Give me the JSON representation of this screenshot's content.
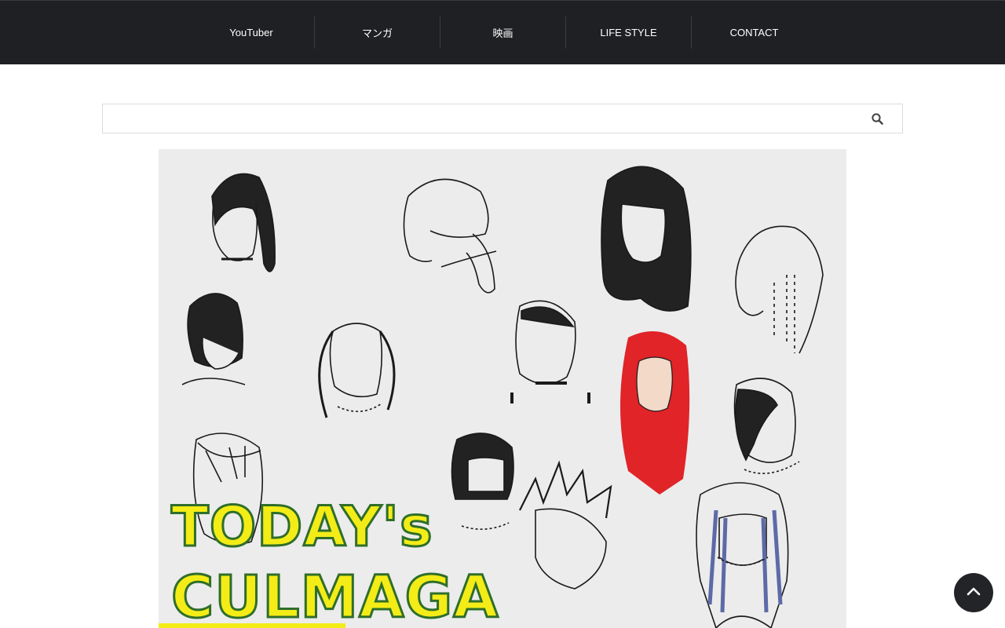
{
  "nav": {
    "items": [
      {
        "label": "YouTuber"
      },
      {
        "label": "マンガ"
      },
      {
        "label": "映画"
      },
      {
        "label": "LIFE STYLE"
      },
      {
        "label": "CONTACT"
      }
    ]
  },
  "search": {
    "placeholder": "",
    "value": "",
    "icon": "search-icon"
  },
  "hero": {
    "headline_line1": "TODAY's",
    "headline_line2": "CULMAGA",
    "image_subject": "hand-drawn sketches of various hairstyles"
  },
  "back_to_top": {
    "icon": "chevron-up-icon"
  },
  "colors": {
    "nav_bg": "#1f2023",
    "headline_fill": "#f3ec17",
    "headline_stroke": "#2f6e2a",
    "accent_red": "#e02428",
    "accent_blue": "#5c6aa8"
  }
}
